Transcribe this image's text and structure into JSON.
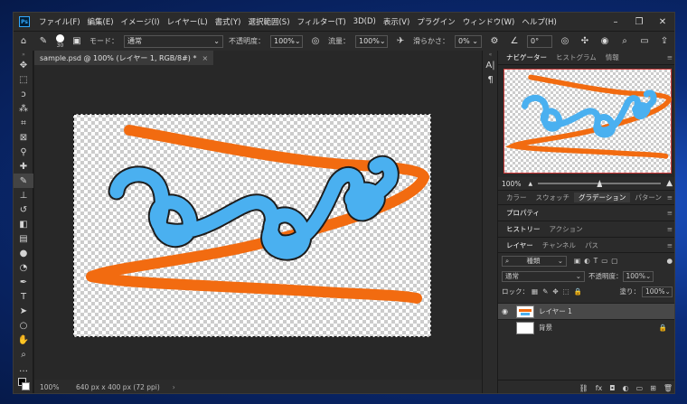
{
  "menu": {
    "app_icon": "Ps",
    "items": [
      "ファイル(F)",
      "編集(E)",
      "イメージ(I)",
      "レイヤー(L)",
      "書式(Y)",
      "選択範囲(S)",
      "フィルター(T)",
      "3D(D)",
      "表示(V)",
      "プラグイン",
      "ウィンドウ(W)",
      "ヘルプ(H)"
    ]
  },
  "options": {
    "brush_size": "30",
    "mode_label": "モード：",
    "mode_value": "通常",
    "opacity_label": "不透明度：",
    "opacity_value": "100%",
    "flow_label": "流量：",
    "flow_value": "100%",
    "smoothing_label": "滑らかさ：",
    "smoothing_value": "0%",
    "angle_value": "0°"
  },
  "document": {
    "tab_title": "sample.psd @ 100% (レイヤー 1, RGB/8#) *",
    "tab_close": "×",
    "zoom": "100%",
    "size_info": "640 px x 400 px (72 ppi)",
    "stroke_colors": {
      "orange": "#f26b10",
      "blue": "#4ab0f0"
    }
  },
  "panels": {
    "nav_tabs": [
      "ナビゲーター",
      "ヒストグラム",
      "情報"
    ],
    "nav_zoom": "100%",
    "color_tabs": [
      "カラー",
      "スウォッチ",
      "グラデーション",
      "パターン"
    ],
    "properties": "プロパティ",
    "history_tabs": [
      "ヒストリー",
      "アクション"
    ],
    "layer_tabs": [
      "レイヤー",
      "チャンネル",
      "パス"
    ],
    "kind_label": "種類",
    "blend_mode": "通常",
    "layer_opacity_label": "不透明度：",
    "layer_opacity_value": "100%",
    "lock_label": "ロック：",
    "fill_label": "塗り：",
    "fill_value": "100%",
    "layers": [
      {
        "name": "レイヤー 1",
        "visible": true
      },
      {
        "name": "背景",
        "visible": false
      }
    ]
  }
}
